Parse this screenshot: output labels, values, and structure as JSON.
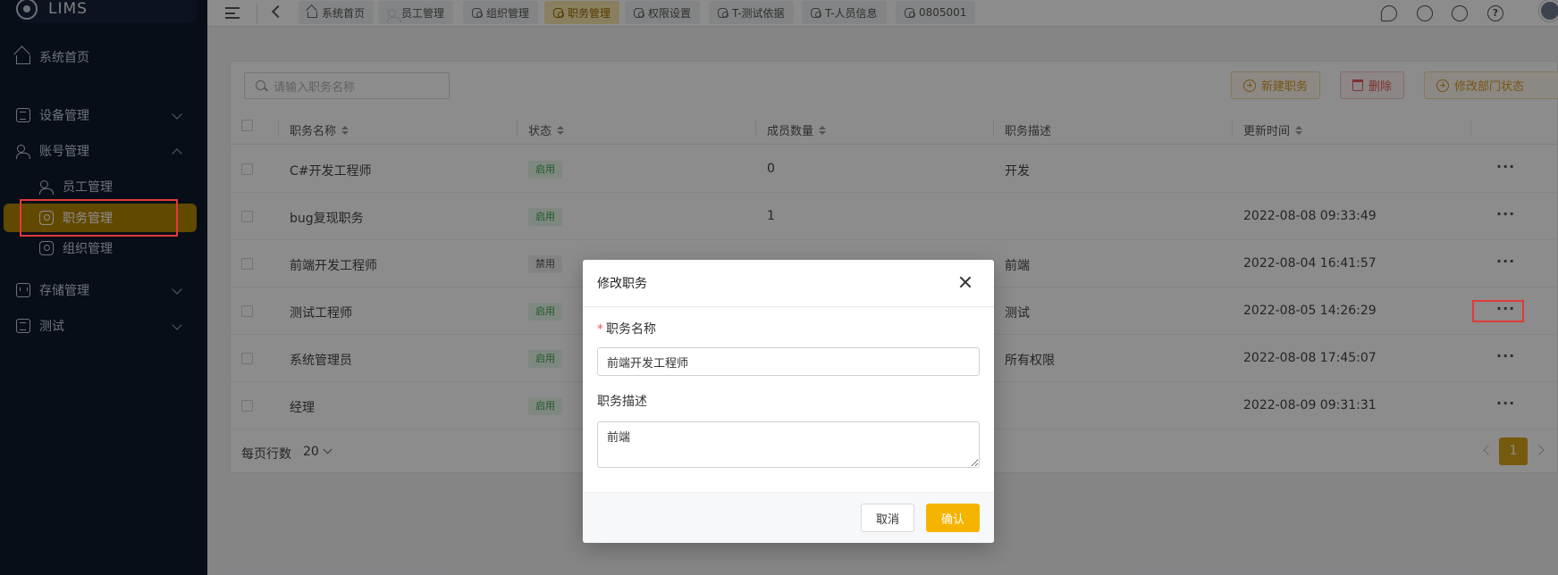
{
  "app": {
    "logo_text": "LIMS"
  },
  "sidebar": {
    "home": "系统首页",
    "device": "设备管理",
    "account": "账号管理",
    "staff": "员工管理",
    "position": "职务管理",
    "org": "组织管理",
    "storage": "存储管理",
    "test": "测试"
  },
  "tabs": [
    "系统首页",
    "员工管理",
    "组织管理",
    "职务管理",
    "权限设置",
    "T-测试依据",
    "T-人员信息",
    "0805001"
  ],
  "toolbar": {
    "search_placeholder": "请输入职务名称",
    "new_label": "新建职务",
    "delete_label": "删除",
    "modify_label": "修改部门状态"
  },
  "table": {
    "headers": {
      "name": "职务名称",
      "status": "状态",
      "count": "成员数量",
      "desc": "职务描述",
      "time": "更新时间"
    },
    "rows": [
      {
        "name": "C#开发工程师",
        "status": "启用",
        "count": "0",
        "desc": "开发",
        "time": ""
      },
      {
        "name": "bug复现职务",
        "status": "启用",
        "count": "1",
        "desc": "",
        "time": "2022-08-08 09:33:49"
      },
      {
        "name": "前端开发工程师",
        "status": "禁用",
        "count": "",
        "desc": "前端",
        "time": "2022-08-04 16:41:57"
      },
      {
        "name": "测试工程师",
        "status": "启用",
        "count": "",
        "desc": "测试",
        "time": "2022-08-05 14:26:29"
      },
      {
        "name": "系统管理员",
        "status": "启用",
        "count": "",
        "desc": "所有权限",
        "time": "2022-08-08 17:45:07"
      },
      {
        "name": "经理",
        "status": "启用",
        "count": "",
        "desc": "",
        "time": "2022-08-09 09:31:31"
      }
    ],
    "more_label": "···"
  },
  "pagination": {
    "rows_per_page_label": "每页行数",
    "page_size": "20",
    "current_page": "1"
  },
  "dialog": {
    "title": "修改职务",
    "required_mark": "*",
    "name_label": "职务名称",
    "name_value": "前端开发工程师",
    "desc_label": "职务描述",
    "desc_value": "前端",
    "cancel_label": "取消",
    "ok_label": "确认"
  },
  "colors": {
    "accent": "#f5b400",
    "sidebar_bg": "#0f1a2b",
    "highlight": "#e03a3a"
  }
}
